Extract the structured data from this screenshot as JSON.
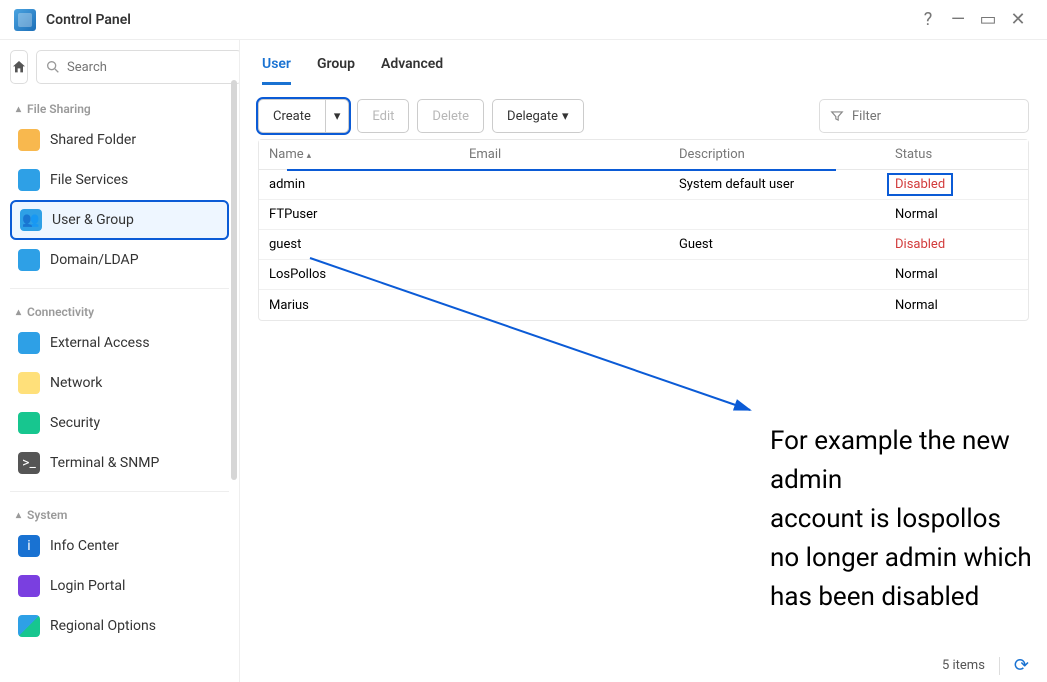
{
  "window": {
    "title": "Control Panel"
  },
  "search": {
    "placeholder": "Search"
  },
  "sidebar": {
    "sections": [
      {
        "label": "File Sharing"
      },
      {
        "label": "Connectivity"
      },
      {
        "label": "System"
      }
    ],
    "items": {
      "shared_folder": "Shared Folder",
      "file_services": "File Services",
      "user_group": "User & Group",
      "domain_ldap": "Domain/LDAP",
      "external_access": "External Access",
      "network": "Network",
      "security": "Security",
      "terminal_snmp": "Terminal & SNMP",
      "info_center": "Info Center",
      "login_portal": "Login Portal",
      "regional_options": "Regional Options"
    }
  },
  "tabs": {
    "user": "User",
    "group": "Group",
    "advanced": "Advanced"
  },
  "toolbar": {
    "create": "Create",
    "edit": "Edit",
    "delete": "Delete",
    "delegate": "Delegate",
    "filter_placeholder": "Filter"
  },
  "columns": {
    "name": "Name",
    "email": "Email",
    "description": "Description",
    "status": "Status"
  },
  "rows": [
    {
      "name": "admin",
      "email": "",
      "description": "System default user",
      "status": "Disabled",
      "status_class": "disabled",
      "highlight": true
    },
    {
      "name": "FTPuser",
      "email": "",
      "description": "",
      "status": "Normal",
      "status_class": "normal"
    },
    {
      "name": "guest",
      "email": "",
      "description": "Guest",
      "status": "Disabled",
      "status_class": "disabled"
    },
    {
      "name": "LosPollos",
      "email": "",
      "description": "",
      "status": "Normal",
      "status_class": "normal"
    },
    {
      "name": "Marius",
      "email": "",
      "description": "",
      "status": "Normal",
      "status_class": "normal"
    }
  ],
  "footer": {
    "count_label": "5 items"
  },
  "annotation": {
    "line1": "For example the new admin",
    "line2": "account is lospollos",
    "line3": "no longer admin which",
    "line4": "has been disabled"
  }
}
